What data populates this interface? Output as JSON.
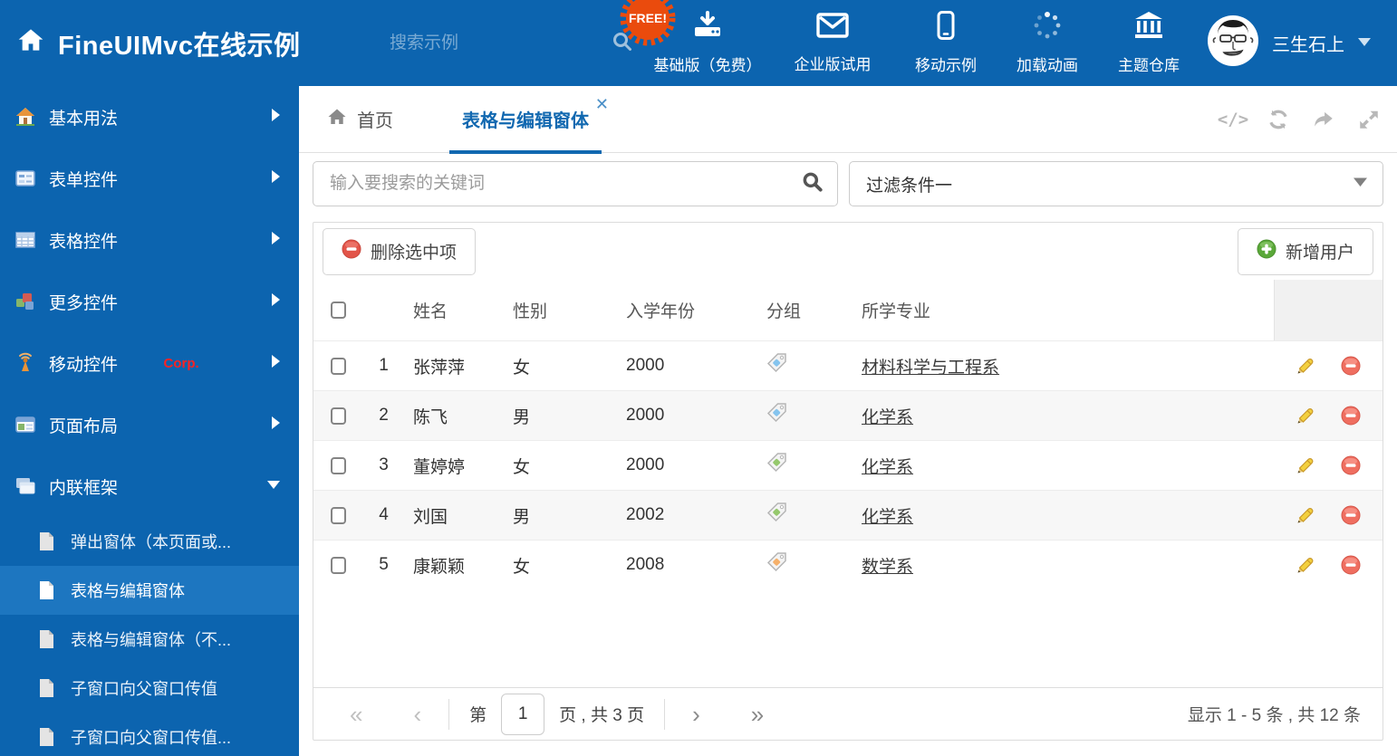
{
  "header": {
    "title": "FineUIMvc在线示例",
    "search_placeholder": "搜索示例",
    "free_badge": "FREE!",
    "nav": [
      {
        "label": "基础版（免费）",
        "icon": "download-icon"
      },
      {
        "label": "企业版试用",
        "icon": "envelope-icon"
      },
      {
        "label": "移动示例",
        "icon": "mobile-icon"
      },
      {
        "label": "加载动画",
        "icon": "spinner-icon"
      },
      {
        "label": "主题仓库",
        "icon": "bank-icon"
      }
    ],
    "user_name": "三生石上"
  },
  "sidebar": {
    "items": [
      {
        "label": "基本用法",
        "icon": "home-icon"
      },
      {
        "label": "表单控件",
        "icon": "form-icon"
      },
      {
        "label": "表格控件",
        "icon": "table-icon"
      },
      {
        "label": "更多控件",
        "icon": "cubes-icon"
      },
      {
        "label": "移动控件",
        "badge": "Corp.",
        "icon": "antenna-icon"
      },
      {
        "label": "页面布局",
        "icon": "layout-icon"
      },
      {
        "label": "内联框架",
        "icon": "frames-icon",
        "expanded": true
      }
    ],
    "subitems": [
      {
        "label": "弹出窗体（本页面或..."
      },
      {
        "label": "表格与编辑窗体",
        "selected": true
      },
      {
        "label": "表格与编辑窗体（不..."
      },
      {
        "label": "子窗口向父窗口传值"
      },
      {
        "label": "子窗口向父窗口传值..."
      }
    ]
  },
  "tabs": {
    "home_label": "首页",
    "active_label": "表格与编辑窗体",
    "close_glyph": "✕"
  },
  "filters": {
    "keyword_placeholder": "输入要搜索的关键词",
    "filter_value": "过滤条件一"
  },
  "toolbar": {
    "delete_label": "删除选中项",
    "add_label": "新增用户"
  },
  "table": {
    "headers": {
      "name": "姓名",
      "gender": "性别",
      "year": "入学年份",
      "group": "分组",
      "major": "所学专业"
    },
    "rows": [
      {
        "num": "1",
        "name": "张萍萍",
        "gender": "女",
        "year": "2000",
        "tag_color": "blue",
        "major": "材料科学与工程系"
      },
      {
        "num": "2",
        "name": "陈飞",
        "gender": "男",
        "year": "2000",
        "tag_color": "blue",
        "major": "化学系"
      },
      {
        "num": "3",
        "name": "董婷婷",
        "gender": "女",
        "year": "2000",
        "tag_color": "green",
        "major": "化学系"
      },
      {
        "num": "4",
        "name": "刘国",
        "gender": "男",
        "year": "2002",
        "tag_color": "green",
        "major": "化学系"
      },
      {
        "num": "5",
        "name": "康颖颖",
        "gender": "女",
        "year": "2008",
        "tag_color": "orange",
        "major": "数学系"
      }
    ]
  },
  "pagination": {
    "first_glyph": "«",
    "prev_glyph": "‹",
    "page_prefix": "第",
    "page_value": "1",
    "page_suffix": "页 , 共 3 页",
    "next_glyph": "›",
    "last_glyph": "»",
    "summary": "显示 1 - 5 条 , 共 12 条"
  },
  "colors": {
    "header_bg": "#0c64af",
    "selected_item_bg": "#1d76c0",
    "accent_blue": "#1168b0",
    "free_badge": "#ea4b0d",
    "tag_blue": "#85c4ee",
    "tag_green": "#95c86c",
    "tag_orange": "#f5b06a",
    "delete_red": "#e25449",
    "add_green": "#5aa839",
    "pencil_yellow": "#f0c040"
  }
}
